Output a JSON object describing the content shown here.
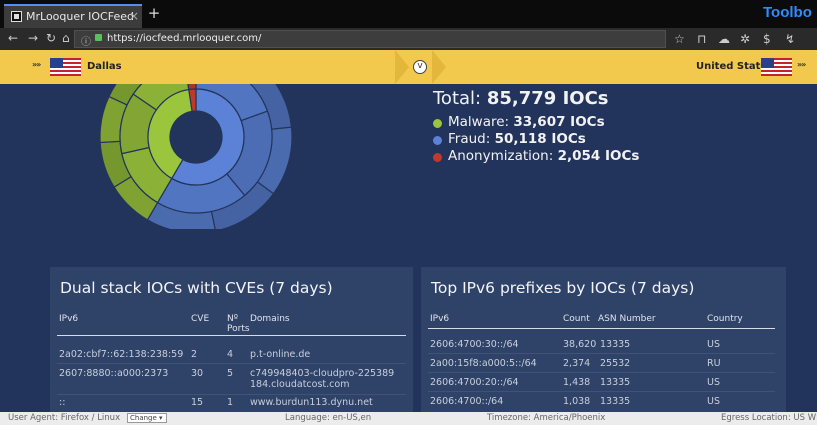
{
  "browser": {
    "tab_title": "MrLooquer IOCFeed",
    "tab_close": "×",
    "new_tab": "+",
    "toolbox_label": "Toolbo",
    "url": "https://iocfeed.mrlooquer.com/"
  },
  "location": {
    "left_arrows": "»»",
    "city": "Dallas",
    "country": "United States",
    "right_arrows": "»»"
  },
  "summary": {
    "total_label": "Total:",
    "total_value": "85,779 IOCs",
    "items": [
      {
        "label": "Malware:",
        "value": "33,607 IOCs",
        "color": "#9bc53d"
      },
      {
        "label": "Fraud:",
        "value": "50,118 IOCs",
        "color": "#5b82d6"
      },
      {
        "label": "Anonymization:",
        "value": "2,054 IOCs",
        "color": "#c0392b"
      }
    ]
  },
  "chart_data": {
    "type": "sunburst",
    "series": [
      {
        "name": "Malware",
        "value": 33607,
        "color": "#9bc53d"
      },
      {
        "name": "Fraud",
        "value": 50118,
        "color": "#5b82d6"
      },
      {
        "name": "Anonymization",
        "value": 2054,
        "color": "#c0392b"
      }
    ]
  },
  "dual_stack": {
    "title": "Dual stack IOCs with CVEs (7 days)",
    "headers": {
      "ipv6": "IPv6",
      "cve": "CVE",
      "ports_a": "Nº",
      "ports_b": "Ports",
      "domains": "Domains"
    },
    "rows": [
      {
        "ipv6": "2a02:cbf7::62:138:238:59",
        "cve": "2",
        "ports": "4",
        "domain": "p.t-online.de"
      },
      {
        "ipv6": "2607:8880::a000:2373",
        "cve": "30",
        "ports": "5",
        "domain": "c749948403-cloudpro-225389184.cloudatcost.com"
      },
      {
        "ipv6": "::",
        "cve": "15",
        "ports": "1",
        "domain": "www.burdun113.dynu.net"
      }
    ]
  },
  "top_prefixes": {
    "title": "Top IPv6 prefixes by IOCs (7 days)",
    "headers": {
      "ipv6": "IPv6",
      "count": "Count",
      "asn": "ASN Number",
      "country": "Country"
    },
    "rows": [
      {
        "ipv6": "2606:4700:30::/64",
        "count": "38,620",
        "asn": "13335",
        "country": "US"
      },
      {
        "ipv6": "2a00:15f8:a000:5::/64",
        "count": "2,374",
        "asn": "25532",
        "country": "RU"
      },
      {
        "ipv6": "2606:4700:20::/64",
        "count": "1,438",
        "asn": "13335",
        "country": "US"
      },
      {
        "ipv6": "2606:4700::/64",
        "count": "1,038",
        "asn": "13335",
        "country": "US"
      }
    ]
  },
  "status": {
    "user_agent": "User Agent:  Firefox / Linux",
    "change": "Change",
    "language": "Language:  en-US,en",
    "timezone": "Timezone:  America/Phoenix",
    "egress": "Egress Location:  US W"
  }
}
